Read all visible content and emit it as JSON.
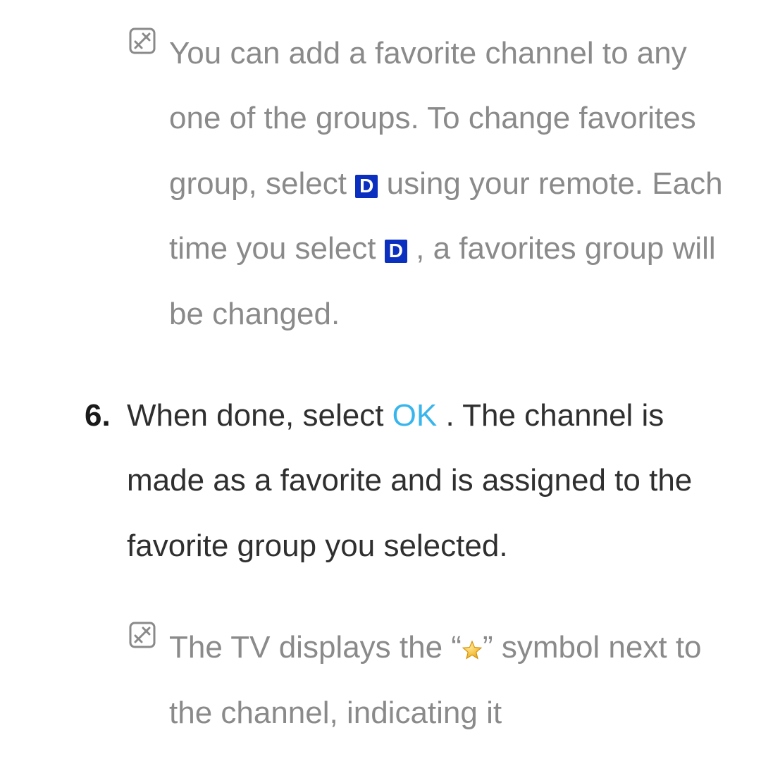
{
  "note1": {
    "part1": "You can add a favorite channel to any one of the groups. To change favorites group, select ",
    "d1": "D",
    "part2": " using your remote. Each time you select ",
    "d2": "D",
    "part3": ", a favorites group will be changed."
  },
  "step6": {
    "number": "6.",
    "part1": "When done, select ",
    "ok": "OK",
    "part2": ". The channel is made as a favorite and is assigned to the favorite group you selected."
  },
  "note2": {
    "part1": "The TV displays the ",
    "open_quote": "“",
    "close_quote": "”",
    "part2": " symbol next to the channel, indicating it"
  },
  "colors": {
    "gray": "#8a8a8a",
    "blue_badge": "#0b2fbf",
    "ok_blue": "#38b5ec",
    "star_fill": "#f6c244",
    "star_stroke": "#d18b00"
  }
}
